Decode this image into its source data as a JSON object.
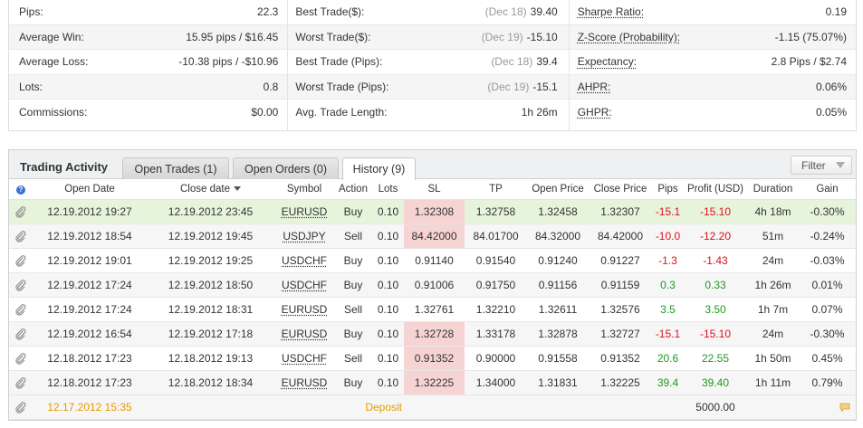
{
  "stats": {
    "col1": [
      {
        "label": "Pips:",
        "value": "22.3"
      },
      {
        "label": "Average Win:",
        "value": "15.95 pips / $16.45"
      },
      {
        "label": "Average Loss:",
        "value": "-10.38 pips / -$10.96"
      },
      {
        "label": "Lots:",
        "value": "0.8"
      },
      {
        "label": "Commissions:",
        "value": "$0.00"
      }
    ],
    "col2": [
      {
        "label": "Best Trade($):",
        "date": "(Dec 18)",
        "value": "39.40"
      },
      {
        "label": "Worst Trade($):",
        "date": "(Dec 19)",
        "value": "-15.10"
      },
      {
        "label": "Best Trade (Pips):",
        "date": "(Dec 18)",
        "value": "39.4"
      },
      {
        "label": "Worst Trade (Pips):",
        "date": "(Dec 19)",
        "value": "-15.1"
      },
      {
        "label": "Avg. Trade Length:",
        "date": "",
        "value": "1h 26m"
      }
    ],
    "col3": [
      {
        "label": "Sharpe Ratio:",
        "value": "0.19"
      },
      {
        "label": "Z-Score (Probability):",
        "value": "-1.15 (75.07%)"
      },
      {
        "label": "Expectancy:",
        "value": "2.8 Pips / $2.74"
      },
      {
        "label": "AHPR:",
        "value": "0.06%"
      },
      {
        "label": "GHPR:",
        "value": "0.05%"
      }
    ]
  },
  "activity": {
    "title": "Trading Activity",
    "tabs": [
      "Open Trades (1)",
      "Open Orders (0)",
      "History (9)"
    ],
    "filter_label": "Filter",
    "help_glyph": "?",
    "columns": [
      "Open Date",
      "Close date",
      "Symbol",
      "Action",
      "Lots",
      "SL",
      "TP",
      "Open Price",
      "Close Price",
      "Pips",
      "Profit (USD)",
      "Duration",
      "Gain"
    ],
    "rows": [
      [
        "12.19.2012 19:27",
        "12.19.2012 23:45",
        "EURUSD",
        "Buy",
        "0.10",
        "1.32308",
        "1.32758",
        "1.32458",
        "1.32307",
        "-15.1",
        "-15.10",
        "4h 18m",
        "-0.30%"
      ],
      [
        "12.19.2012 18:54",
        "12.19.2012 19:45",
        "USDJPY",
        "Sell",
        "0.10",
        "84.42000",
        "84.01700",
        "84.32000",
        "84.42000",
        "-10.0",
        "-12.20",
        "51m",
        "-0.24%"
      ],
      [
        "12.19.2012 19:01",
        "12.19.2012 19:25",
        "USDCHF",
        "Buy",
        "0.10",
        "0.91140",
        "0.91540",
        "0.91240",
        "0.91227",
        "-1.3",
        "-1.43",
        "24m",
        "-0.03%"
      ],
      [
        "12.19.2012 17:24",
        "12.19.2012 18:50",
        "USDCHF",
        "Buy",
        "0.10",
        "0.91006",
        "0.91750",
        "0.91156",
        "0.91159",
        "0.3",
        "0.33",
        "1h 26m",
        "0.01%"
      ],
      [
        "12.19.2012 17:24",
        "12.19.2012 18:31",
        "EURUSD",
        "Sell",
        "0.10",
        "1.32761",
        "1.32210",
        "1.32611",
        "1.32576",
        "3.5",
        "3.50",
        "1h 7m",
        "0.07%"
      ],
      [
        "12.19.2012 16:54",
        "12.19.2012 17:18",
        "EURUSD",
        "Buy",
        "0.10",
        "1.32728",
        "1.33178",
        "1.32878",
        "1.32727",
        "-15.1",
        "-15.10",
        "24m",
        "-0.30%"
      ],
      [
        "12.18.2012 17:23",
        "12.18.2012 19:13",
        "USDCHF",
        "Sell",
        "0.10",
        "0.91352",
        "0.90000",
        "0.91558",
        "0.91352",
        "20.6",
        "22.55",
        "1h 50m",
        "0.45%"
      ],
      [
        "12.18.2012 17:23",
        "12.18.2012 18:34",
        "EURUSD",
        "Buy",
        "0.10",
        "1.32225",
        "1.34000",
        "1.31831",
        "1.32225",
        "39.4",
        "39.40",
        "1h 11m",
        "0.79%"
      ]
    ],
    "sl_highlight": [
      true,
      true,
      false,
      false,
      false,
      true,
      true,
      true
    ],
    "deposit": {
      "date": "12.17.2012 15:35",
      "label": "Deposit",
      "amount": "5000.00"
    }
  },
  "colors": {
    "negative": "#e0101a",
    "positive": "#1f9a1f",
    "deposit": "#e59a00",
    "highlight_row": "#e6f4dc",
    "sl_highlight": "#f7d4d4"
  }
}
